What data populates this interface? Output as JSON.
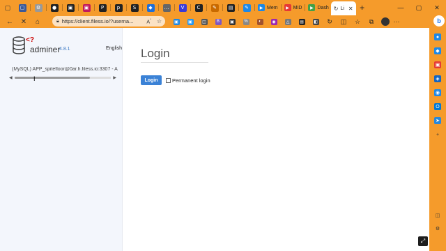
{
  "browser": {
    "tabs": [
      {
        "type": "icon",
        "icon": "windows-icon",
        "color": "#3b5998",
        "glyph": "▢"
      },
      {
        "type": "icon",
        "icon": "favicon-gear-icon",
        "color": "#999999",
        "glyph": "⚙"
      },
      {
        "type": "icon",
        "icon": "github-icon",
        "color": "#222222",
        "glyph": "●"
      },
      {
        "type": "icon",
        "icon": "imdb-icon",
        "color": "#222222",
        "glyph": "▣"
      },
      {
        "type": "icon",
        "icon": "tv-icon",
        "color": "#c2185b",
        "glyph": "▣"
      },
      {
        "type": "icon",
        "icon": "pinterest-icon",
        "color": "#222222",
        "glyph": "P"
      },
      {
        "type": "icon",
        "icon": "p-icon",
        "color": "#222222",
        "glyph": "p"
      },
      {
        "type": "icon",
        "icon": "s-icon",
        "color": "#222222",
        "glyph": "S"
      },
      {
        "type": "icon",
        "icon": "vpn-icon",
        "color": "#1e6fd9",
        "glyph": "◆"
      },
      {
        "type": "icon",
        "icon": "dots-icon",
        "color": "#666666",
        "glyph": "…"
      },
      {
        "type": "icon",
        "icon": "vp-icon",
        "color": "#3a3ad6",
        "glyph": "V"
      },
      {
        "type": "icon",
        "icon": "c-icon",
        "color": "#222222",
        "glyph": "C"
      },
      {
        "type": "icon",
        "icon": "pen-icon",
        "color": "#c96a00",
        "glyph": "✎"
      },
      {
        "type": "icon",
        "icon": "chart-icon",
        "color": "#222222",
        "glyph": "▤"
      },
      {
        "type": "icon",
        "icon": "edit-icon",
        "color": "#1e88e5",
        "glyph": "✎"
      }
    ],
    "text_tabs": [
      {
        "icon": "nf-icon",
        "color": "#1e88e5",
        "label": "Mem"
      },
      {
        "icon": "youtube-icon",
        "color": "#e53935",
        "label": "MID"
      },
      {
        "icon": "dash-icon",
        "color": "#43a047",
        "label": "Dash"
      }
    ],
    "active_tab": {
      "label": "Li",
      "icon": "loading-icon"
    },
    "url": "https://client.filess.io/?userna...",
    "accent_color": "#f59b2b"
  },
  "adminer": {
    "brand": "adminer",
    "version": "4.8.1",
    "language": "English",
    "db_line": "(MySQL) APP_spitefloor@0ar.h.filess.io:3307 - A",
    "title": "Login",
    "login_button": "Login",
    "permanent_login_label": "Permanent login",
    "permanent_login_checked": false
  }
}
